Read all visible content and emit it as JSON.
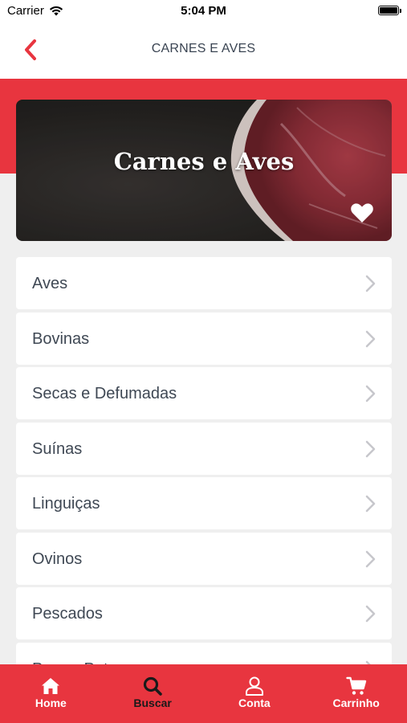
{
  "status_bar": {
    "carrier": "Carrier",
    "time": "5:04 PM"
  },
  "nav": {
    "title": "CARNES E AVES",
    "back_icon": "chevron-left-icon"
  },
  "banner": {
    "title": "Carnes e Aves",
    "favorite_icon": "heart-icon"
  },
  "categories": [
    {
      "label": "Aves"
    },
    {
      "label": "Bovinas"
    },
    {
      "label": "Secas e Defumadas"
    },
    {
      "label": "Suínas"
    },
    {
      "label": "Linguiças"
    },
    {
      "label": "Ovinos"
    },
    {
      "label": "Pescados"
    },
    {
      "label": "Peru e Pato"
    }
  ],
  "tabs": [
    {
      "label": "Home",
      "icon": "home-icon",
      "active": false
    },
    {
      "label": "Buscar",
      "icon": "search-icon",
      "active": true
    },
    {
      "label": "Conta",
      "icon": "user-icon",
      "active": false
    },
    {
      "label": "Carrinho",
      "icon": "cart-icon",
      "active": false
    }
  ],
  "colors": {
    "accent": "#e8353f",
    "active_tab": "#1a1a1a",
    "text": "#3f4854"
  }
}
